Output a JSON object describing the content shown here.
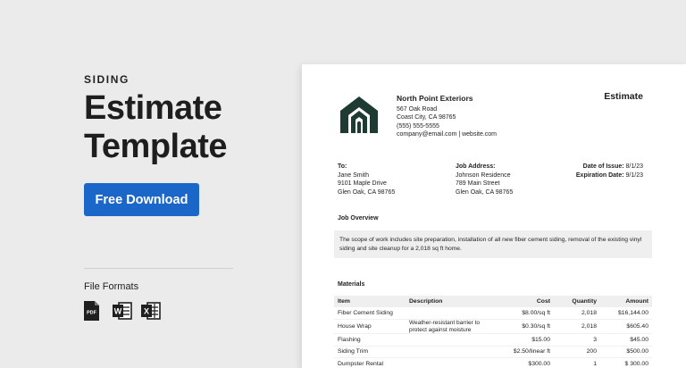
{
  "promo": {
    "eyebrow": "SIDING",
    "title_line1": "Estimate",
    "title_line2": "Template",
    "download_label": "Free Download",
    "file_formats_label": "File Formats",
    "formats": [
      "pdf-icon",
      "word-icon",
      "excel-icon"
    ],
    "format_letters": {
      "pdf": "PDF",
      "word": "W",
      "excel": "X"
    },
    "colors": {
      "button": "#1b66c9",
      "background": "#ebebeb"
    }
  },
  "doc": {
    "title": "Estimate",
    "company": {
      "name": "North Point Exteriors",
      "address1": "567 Oak Road",
      "address2": "Coast City, CA 98765",
      "phone": "(555) 555-5555",
      "contact": "company@email.com | website.com"
    },
    "to": {
      "label": "To:",
      "name": "Jane Smith",
      "address1": "9101 Maple Drive",
      "address2": "Glen Oak, CA 98765"
    },
    "job_address": {
      "label": "Job Address:",
      "name": "Johnson Residence",
      "address1": "789 Main Street",
      "address2": "Glen Oak, CA 98765"
    },
    "dates": {
      "issue_label": "Date of Issue:",
      "issue_value": "8/1/23",
      "exp_label": "Expiration Date:",
      "exp_value": "9/1/23"
    },
    "overview": {
      "heading": "Job Overview",
      "text": "The scope of work includes site preparation, installation of all new fiber cement siding, removal of the existing vinyl siding and site cleanup for a 2,018 sq ft home."
    },
    "materials": {
      "heading": "Materials",
      "headers": {
        "item": "Item",
        "description": "Description",
        "cost": "Cost",
        "quantity": "Quantity",
        "amount": "Amount"
      },
      "rows": [
        {
          "item": "Fiber Cement Siding",
          "description": "",
          "cost": "$8.00/sq ft",
          "quantity": "2,018",
          "amount": "$16,144.00"
        },
        {
          "item": "House Wrap",
          "description": "Weather-resistant barrier to protect against moisture",
          "cost": "$0.30/sq ft",
          "quantity": "2,018",
          "amount": "$605.40"
        },
        {
          "item": "Flashing",
          "description": "",
          "cost": "$15.00",
          "quantity": "3",
          "amount": "$45.00"
        },
        {
          "item": "Siding Trim",
          "description": "",
          "cost": "$2.50/linear ft",
          "quantity": "200",
          "amount": "$500.00"
        },
        {
          "item": "Dumpster Rental",
          "description": "",
          "cost": "$300.00",
          "quantity": "1",
          "amount": "$ 300.00"
        }
      ]
    }
  }
}
